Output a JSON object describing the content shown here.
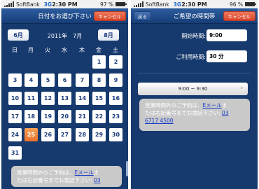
{
  "left": {
    "status": {
      "carrier": "SoftBank",
      "network": "3G",
      "time": "2:30 PM",
      "battery": "97 %",
      "battery_level": 0.97
    },
    "header": {
      "back_label": "",
      "title": "日付をお選び下さい",
      "cancel_label": "キャンセル"
    },
    "calendar": {
      "prev_month_label": "6月",
      "month_title": "2011年　7月",
      "next_month_label": "8月",
      "weekdays": [
        "日",
        "月",
        "火",
        "水",
        "木",
        "金",
        "土"
      ],
      "first_weekday_index": 5,
      "days_in_month": 31,
      "selected_day": 25
    },
    "notice": {
      "line1": "営業時間外のご予約は、",
      "link": "Eメール",
      "line1b": "ま",
      "line2": "たは右記番号までお電話下さい: ",
      "phone": "03"
    }
  },
  "right": {
    "status": {
      "carrier": "SoftBank",
      "network": "3G",
      "time": "2:30 PM",
      "battery": "96 %",
      "battery_level": 0.96
    },
    "header": {
      "back_label": "戻る",
      "title": "ご希望の時間帯",
      "cancel_label": "キャンセル"
    },
    "form": {
      "start_label": "開始時間:",
      "start_value": "9:00",
      "duration_label": "ご利用時間:",
      "duration_value": "30 分"
    },
    "slot": {
      "label": "9:00 ~ 9:30"
    },
    "notice": {
      "line1": "営業時間外のご予約は、",
      "link": "Eメール",
      "line1b": "ま",
      "line2": "たは右記番号までお電話下さい: ",
      "phone1": "03",
      "phone2": "6717 4500"
    }
  }
}
